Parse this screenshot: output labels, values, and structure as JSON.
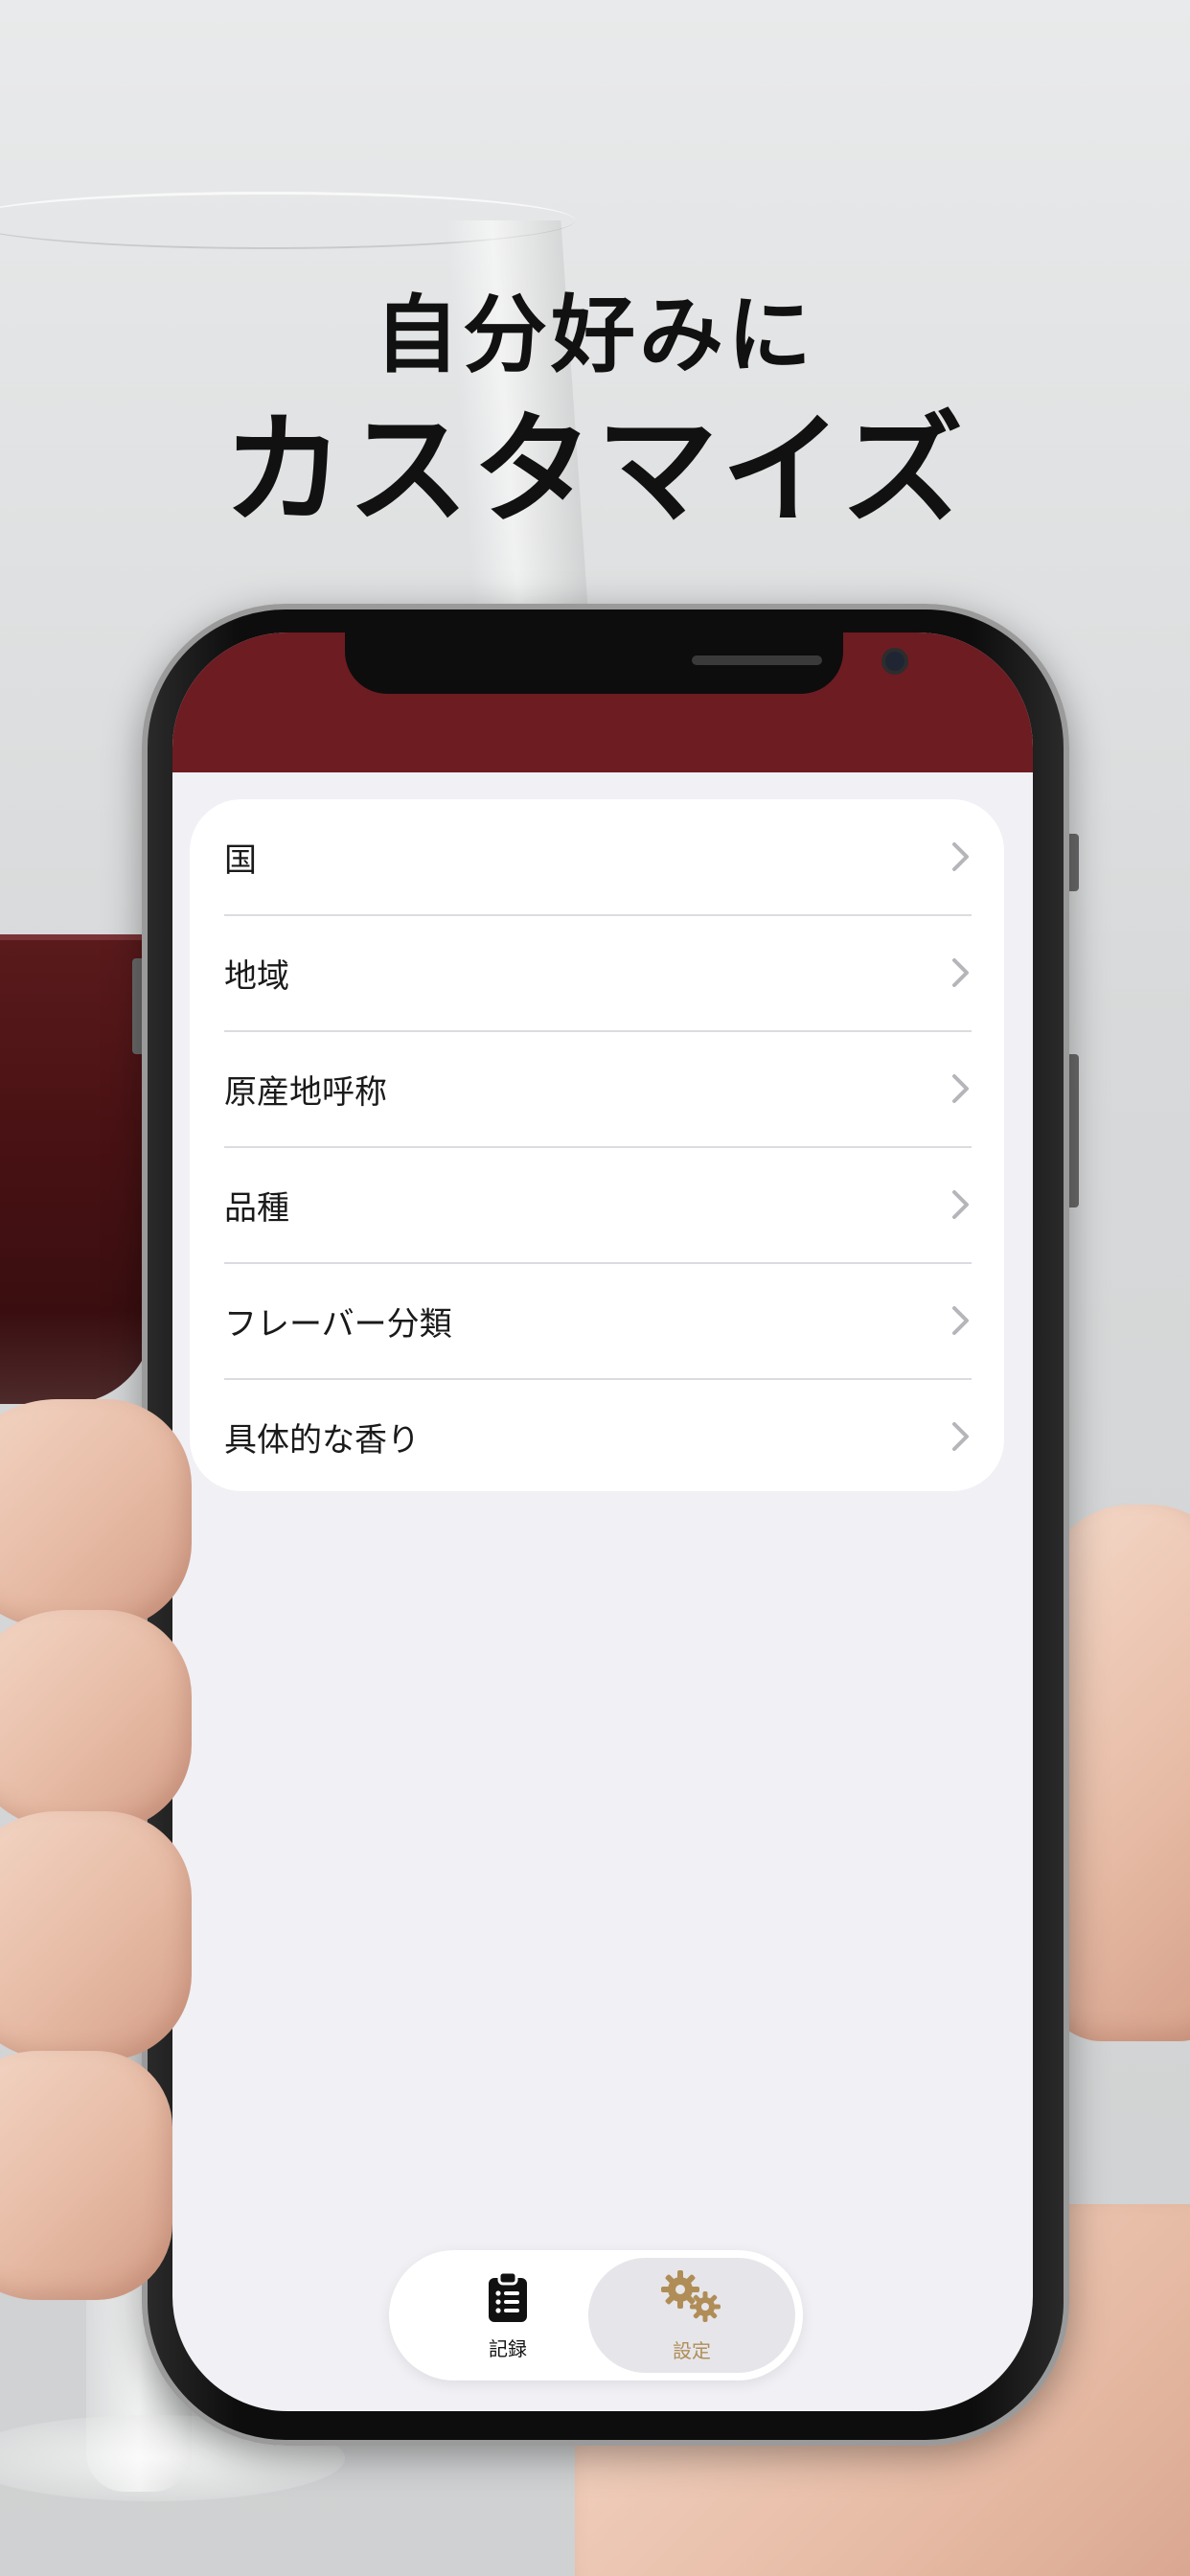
{
  "headline": {
    "line1": "自分好みに",
    "line2": "カスタマイズ"
  },
  "settings_list": {
    "items": [
      {
        "label": "国"
      },
      {
        "label": "地域"
      },
      {
        "label": "原産地呼称"
      },
      {
        "label": "品種"
      },
      {
        "label": "フレーバー分類"
      },
      {
        "label": "具体的な香り"
      }
    ],
    "row_icon": "chevron-right-icon"
  },
  "tab_bar": {
    "tabs": [
      {
        "label": "記録",
        "icon": "clipboard-list-icon",
        "selected": false
      },
      {
        "label": "設定",
        "icon": "gears-icon",
        "selected": true
      }
    ]
  },
  "colors": {
    "header": "#6d1c22",
    "screen_bg": "#f0f0f5",
    "accent_gold": "#b08d57",
    "text": "#1a1a1a"
  }
}
